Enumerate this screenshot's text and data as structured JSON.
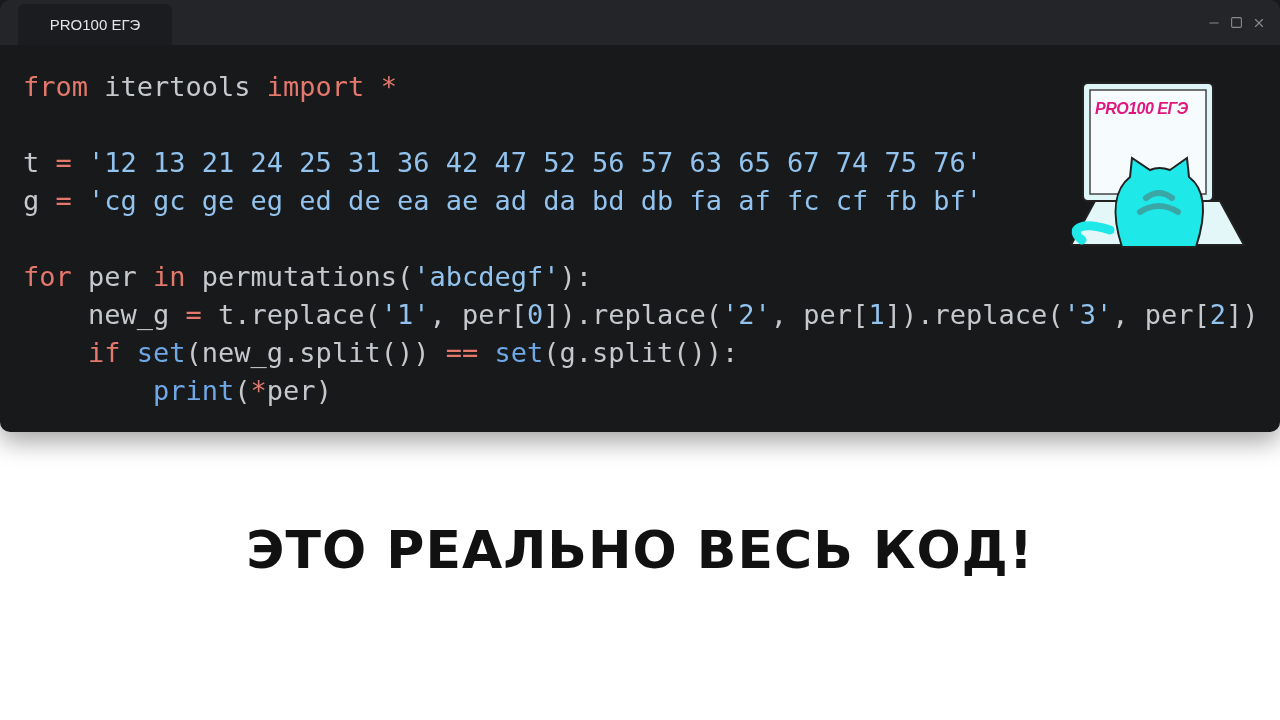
{
  "window": {
    "tab": {
      "label": "PRO100 ЕГЭ",
      "selected": true
    }
  },
  "code_blocks": [
    [
      [
        {
          "kind": "keyword",
          "text": "from"
        },
        {
          "kind": "plain",
          "text": " itertools "
        },
        {
          "kind": "keyword",
          "text": "import"
        },
        {
          "kind": "operator",
          "text": " *"
        }
      ]
    ],
    [
      [
        {
          "kind": "plain",
          "text": "t "
        },
        {
          "kind": "operator",
          "text": "="
        },
        {
          "kind": "string",
          "text": " '12 13 21 24 25 31 36 42 47 52 56 57 63 65 67 74 75 76'"
        }
      ],
      [
        {
          "kind": "plain",
          "text": "g "
        },
        {
          "kind": "operator",
          "text": "="
        },
        {
          "kind": "string",
          "text": " 'cg gc ge eg ed de ea ae ad da bd db fa af fc cf fb bf'"
        }
      ]
    ],
    [
      [
        {
          "kind": "keyword",
          "text": "for"
        },
        {
          "kind": "plain",
          "text": " per "
        },
        {
          "kind": "keyword",
          "text": "in"
        },
        {
          "kind": "plain",
          "text": " permutations("
        },
        {
          "kind": "string",
          "text": "'abcdegf'"
        },
        {
          "kind": "plain",
          "text": "):"
        }
      ],
      [
        {
          "kind": "plain",
          "text": "    new_g "
        },
        {
          "kind": "operator",
          "text": "="
        },
        {
          "kind": "plain",
          "text": " t.replace("
        },
        {
          "kind": "string",
          "text": "'1'"
        },
        {
          "kind": "plain",
          "text": ", per["
        },
        {
          "kind": "string",
          "text": "0"
        },
        {
          "kind": "plain",
          "text": "]).replace("
        },
        {
          "kind": "string",
          "text": "'2'"
        },
        {
          "kind": "plain",
          "text": ", per["
        },
        {
          "kind": "string",
          "text": "1"
        },
        {
          "kind": "plain",
          "text": "]).replace("
        },
        {
          "kind": "string",
          "text": "'3'"
        },
        {
          "kind": "plain",
          "text": ", per["
        },
        {
          "kind": "string",
          "text": "2"
        },
        {
          "kind": "plain",
          "text": "])"
        }
      ],
      [
        {
          "kind": "keyword",
          "text": "    if"
        },
        {
          "kind": "builtin",
          "text": " set"
        },
        {
          "kind": "plain",
          "text": "(new_g.split()) "
        },
        {
          "kind": "operator",
          "text": "=="
        },
        {
          "kind": "builtin",
          "text": " set"
        },
        {
          "kind": "plain",
          "text": "(g.split()):"
        }
      ],
      [
        {
          "kind": "builtin",
          "text": "        print"
        },
        {
          "kind": "plain",
          "text": "("
        },
        {
          "kind": "operator",
          "text": "*"
        },
        {
          "kind": "plain",
          "text": "per)"
        }
      ]
    ]
  ],
  "logo": {
    "text": "PRO100 ЕГЭ"
  },
  "caption": "ЭТО РЕАЛЬНО ВЕСЬ КОД!"
}
